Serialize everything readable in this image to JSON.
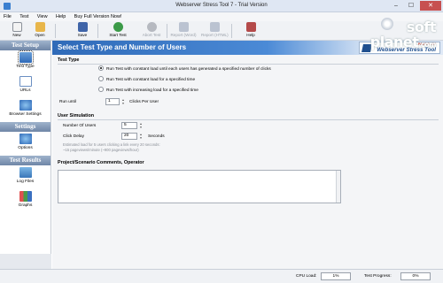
{
  "window": {
    "title": "Webserver Stress Tool 7 - Trial Version",
    "min_glyph": "‒",
    "max_glyph": "☐",
    "close_glyph": "✕"
  },
  "menu": [
    "File",
    "Test",
    "View",
    "Help",
    "Buy Full Version Now!"
  ],
  "toolbar": [
    {
      "label": "New",
      "icon": "new-icon",
      "enabled": true
    },
    {
      "label": "Open",
      "icon": "open-icon",
      "enabled": true
    },
    {
      "label": "Save",
      "icon": "save-icon",
      "enabled": true
    },
    {
      "label": "Start Test",
      "icon": "start-test-icon",
      "enabled": true
    },
    {
      "label": "Abort Test",
      "icon": "abort-test-icon",
      "enabled": false
    },
    {
      "label": "Report (Word)",
      "icon": "report-word-icon",
      "enabled": false
    },
    {
      "label": "Report (HTML)",
      "icon": "report-html-icon",
      "enabled": false
    },
    {
      "label": "Help",
      "icon": "help-icon",
      "enabled": true
    }
  ],
  "nav": {
    "test_setup": "Test Setup",
    "test_type": "Test Type",
    "urls": "URLs",
    "browser_settings": "Browser Settings",
    "settings": "Settings",
    "options": "Options",
    "test_results": "Test Results",
    "log_files": "Log Files",
    "graphs": "Graphs"
  },
  "main": {
    "banner_title": "Select Test Type and Number of Users",
    "logo_brand": "PAESSLER",
    "logo_product": "Webserver Stress Tool",
    "test_type_heading": "Test Type",
    "options": [
      "Run Test with constant load until each users has generated a specified number of clicks",
      "Run Test with constant load for a specified time",
      "Run Test with increasing load for a specified time"
    ],
    "selected_option": 0,
    "run_until_label": "Run until",
    "run_until_value": "1",
    "run_until_unit": "Clicks Per User",
    "user_sim_heading": "User Simulation",
    "num_users_label": "Number Of Users",
    "num_users_value": "5",
    "click_delay_label": "Click Delay",
    "click_delay_value": "20",
    "click_delay_unit": "Seconds",
    "estimate_line1": "Estimated load for 5 users clicking a link every 20 seconds:",
    "estimate_line2": "~15 pageviews/minute (~900 pageviews/hour)",
    "comments_heading": "Project/Scenario Comments, Operator",
    "comments_value": ""
  },
  "statusbar": {
    "cpu_label": "CPU Load:",
    "cpu_value": "1%",
    "progress_label": "Test Progress:",
    "progress_value": "0%"
  },
  "watermark": {
    "line1": "soft",
    "line2": "planet",
    "tld": ".com"
  },
  "colors": {
    "banner": "#2f6ab8",
    "nav_header": "#7a90ae",
    "close": "#c75050"
  }
}
